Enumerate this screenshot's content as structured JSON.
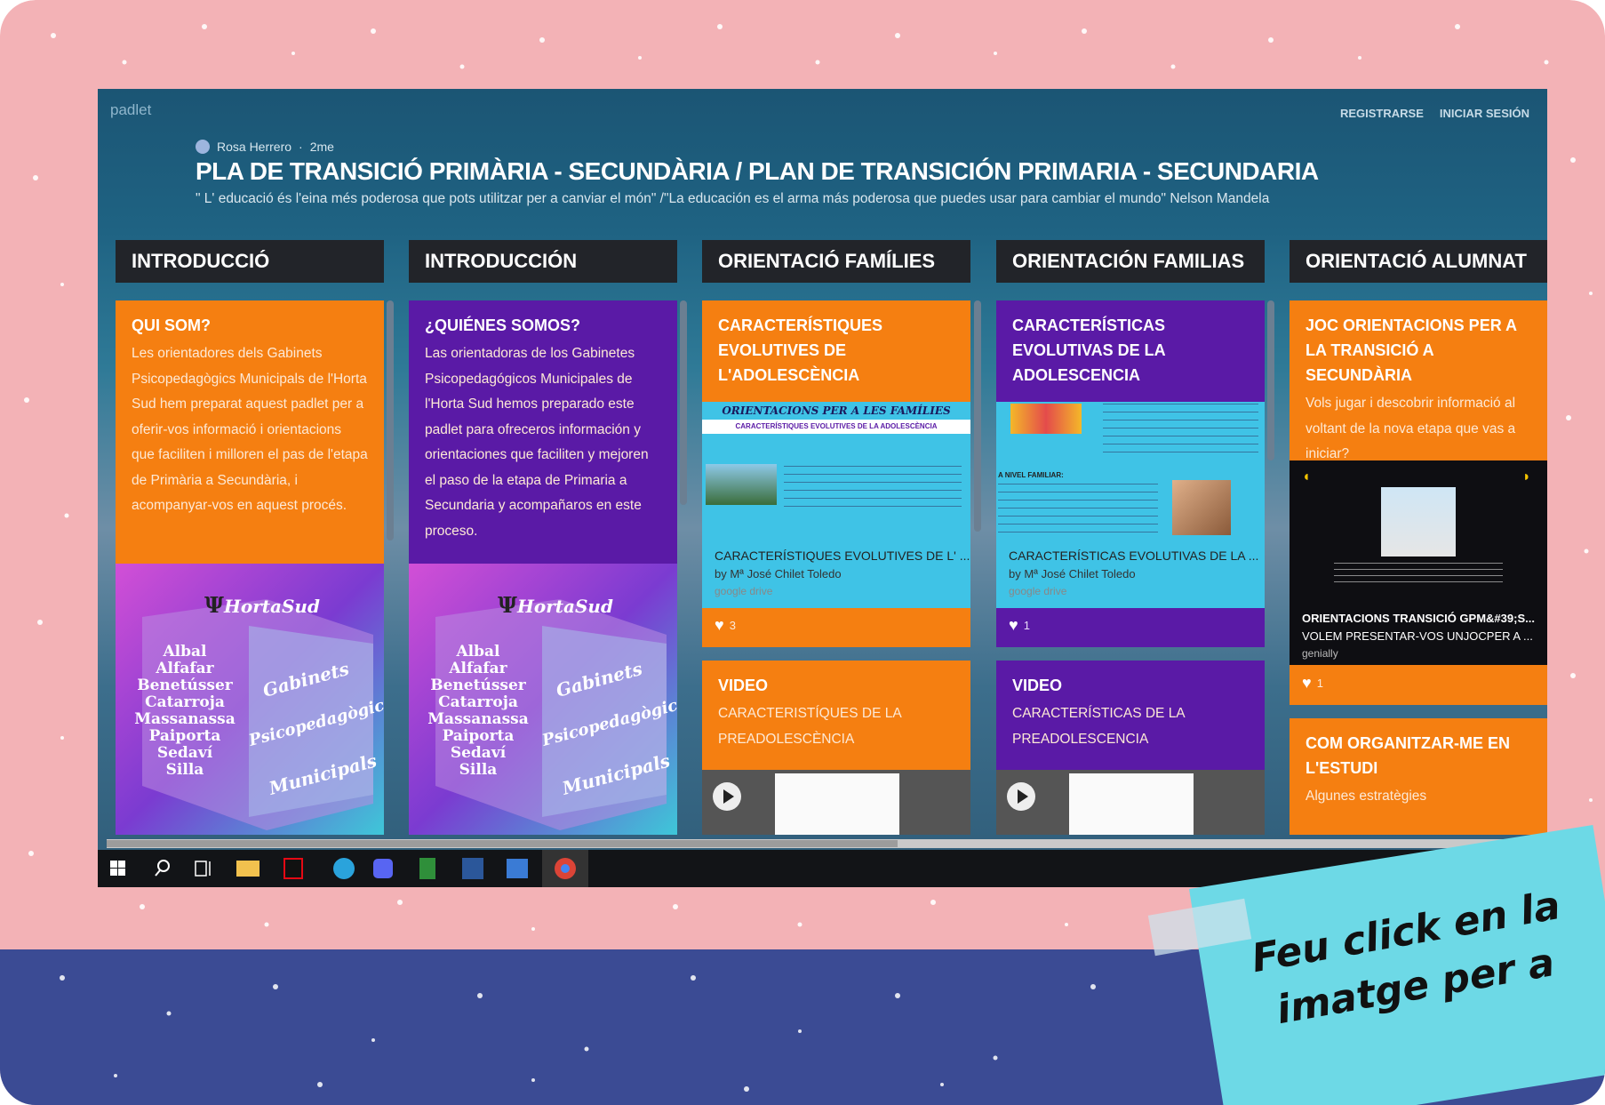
{
  "app": {
    "logo": "padlet",
    "links": [
      "REGISTRARSE",
      "INICIAR SESIÓN"
    ]
  },
  "board": {
    "author": "Rosa Herrero",
    "time": "2me",
    "title": "PLA DE TRANSICIÓ PRIMÀRIA - SECUNDÀRIA / PLAN DE TRANSICIÓN PRIMARIA - SECUNDARIA",
    "subtitle": "\" L' educació és l'eina més poderosa que pots utilitzar per a canviar el món\" /\"La educación es el arma más poderosa que puedes usar para cambiar el mundo\" Nelson Mandela"
  },
  "columns": [
    {
      "title": "INTRODUCCIÓ"
    },
    {
      "title": "INTRODUCCIÓN"
    },
    {
      "title": "ORIENTACIÓ FAMÍLIES"
    },
    {
      "title": "ORIENTACIÓN FAMILIAS"
    },
    {
      "title": "ORIENTACIÓ ALUMNAT"
    }
  ],
  "cards": {
    "c1": {
      "title": "QUI SOM?",
      "body": "Les orientadores dels Gabinets Psicopedagògics Municipals de l'Horta Sud hem preparat aquest padlet per a oferir-vos informació i orientacions que faciliten i milloren el pas de l'etapa de Primària a Secundària, i acompanyar-vos en aquest procés."
    },
    "c2": {
      "title": "¿QUIÉNES SOMOS?",
      "body": "Las orientadoras de los Gabinetes Psicopedagógicos Municipales de l'Horta Sud hemos preparado este padlet para ofreceros información y orientaciones que faciliten y mejoren el paso de la etapa de Primaria a Secundaria y acompañaros en este proceso."
    },
    "c3": {
      "title": "CARACTERÍSTIQUES EVOLUTIVES DE L'ADOLESCÈNCIA",
      "banner": "ORIENTACIONS PER A LES FAMÍLIES",
      "banner_sub": "CARACTERÍSTIQUES EVOLUTIVES DE LA ADOLESCÈNCIA",
      "link_title": "CARACTERÍSTIQUES EVOLUTIVES DE L' ...",
      "by": "by Mª José Chilet Toledo",
      "source": "google drive",
      "likes": "3"
    },
    "c4": {
      "title": "CARACTERÍSTICAS EVOLUTIVAS DE LA ADOLESCENCIA",
      "link_title": "CARACTERÍSTICAS EVOLUTIVAS DE LA ...",
      "by": "by Mª José Chilet Toledo",
      "source": "google drive",
      "likes": "1",
      "mini": "A NIVEL FAMILIAR:"
    },
    "c5": {
      "title": "JOC ORIENTACIONS PER A LA TRANSICIÓ A SECUNDÀRIA",
      "body": "Vols jugar i descobrir informació al voltant de la nova etapa que vas a iniciar?",
      "link_title": "ORIENTACIONS TRANSICIÓ GPM&#39;S...",
      "link_desc": "VOLEM PRESENTAR-VOS UNJOCPER A ...",
      "source": "genially",
      "likes": "1"
    },
    "c6": {
      "title": "VIDEO",
      "body": "CARACTERISTÍQUES DE LA PREADOLESCÈNCIA"
    },
    "c7": {
      "title": "VIDEO",
      "body": "CARACTERÍSTICAS DE LA PREADOLESCENCIA"
    },
    "c8": {
      "title": "COM ORGANITZAR-ME EN L'ESTUDI",
      "body": "Algunes estratègies"
    }
  },
  "logo_card": {
    "brand": "HortaSud",
    "towns": [
      "Albal",
      "Alfafar",
      "Benetússer",
      "Catarroja",
      "Massanassa",
      "Paiporta",
      "Sedaví",
      "Silla"
    ],
    "words": [
      "Gabinets",
      "Psicopedagògics",
      "Municipals"
    ]
  },
  "note": {
    "text": "Feu click en la imatge per a"
  },
  "colors": {
    "pink": "#f3b2b6",
    "navy": "#3b4b94",
    "orange": "#f57f11",
    "purple": "#5a1aa6",
    "cyan": "#6dd9e6"
  }
}
